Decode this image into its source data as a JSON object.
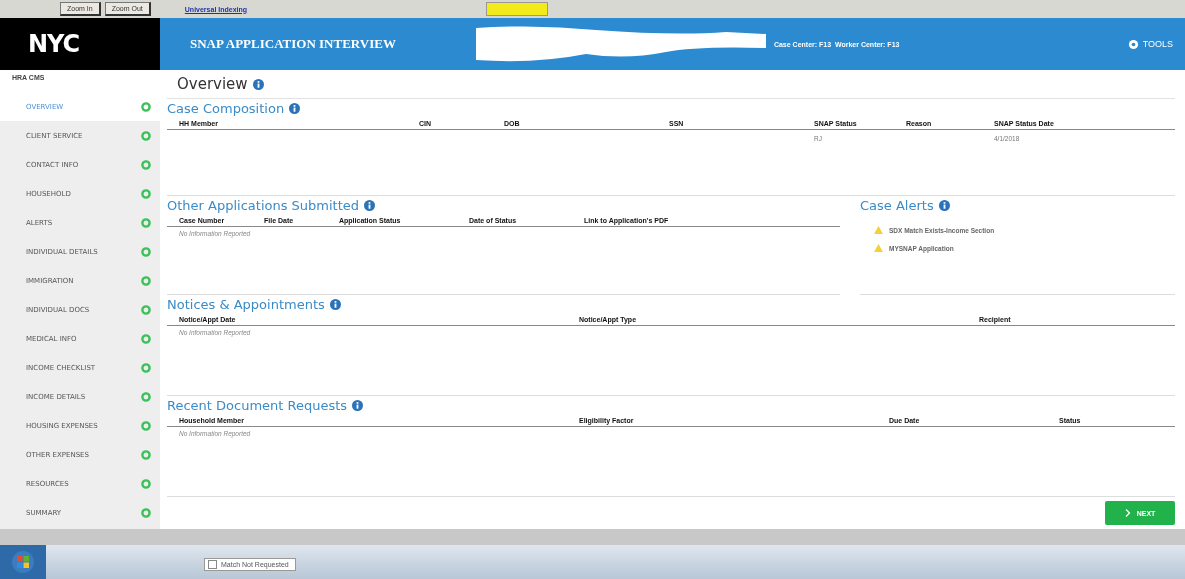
{
  "toolbar": {
    "buttons": [
      "Zoom In",
      "Zoom Out"
    ],
    "link": "Universal Indexing"
  },
  "header": {
    "logo": "NYC",
    "title": "SNAP APPLICATION INTERVIEW",
    "centers": "Case Center: F13  Worker Center: F13",
    "tools": "TOOLS"
  },
  "sidebar": {
    "caption": "HRA CMS",
    "items": [
      {
        "label": "OVERVIEW",
        "selected": true
      },
      {
        "label": "CLIENT SERVICE",
        "selected": false
      },
      {
        "label": "CONTACT INFO",
        "selected": false
      },
      {
        "label": "HOUSEHOLD",
        "selected": false
      },
      {
        "label": "ALERTS",
        "selected": false
      },
      {
        "label": "INDIVIDUAL DETAILS",
        "selected": false
      },
      {
        "label": "IMMIGRATION",
        "selected": false
      },
      {
        "label": "INDIVIDUAL DOCS",
        "selected": false
      },
      {
        "label": "MEDICAL INFO",
        "selected": false
      },
      {
        "label": "INCOME CHECKLIST",
        "selected": false
      },
      {
        "label": "INCOME DETAILS",
        "selected": false
      },
      {
        "label": "HOUSING EXPENSES",
        "selected": false
      },
      {
        "label": "OTHER EXPENSES",
        "selected": false
      },
      {
        "label": "RESOURCES",
        "selected": false
      },
      {
        "label": "SUMMARY",
        "selected": false
      }
    ]
  },
  "page_title": "Overview",
  "case_composition": {
    "title": "Case Composition",
    "columns": [
      "HH Member",
      "CIN",
      "DOB",
      "SSN",
      "SNAP Status",
      "Reason",
      "SNAP Status Date"
    ],
    "rows": [
      {
        "snap_status": "RJ",
        "snap_status_date": "4/1/2018"
      }
    ]
  },
  "other_applications": {
    "title": "Other Applications Submitted",
    "columns": [
      "Case Number",
      "File Date",
      "Application Status",
      "Date of Status",
      "Link to Application's PDF"
    ],
    "empty": "No Information Reported"
  },
  "case_alerts": {
    "title": "Case Alerts",
    "items": [
      "SDX Match Exists-Income Section",
      "MYSNAP Application"
    ]
  },
  "notices": {
    "title": "Notices & Appointments",
    "columns": [
      "Notice/Appt Date",
      "Notice/Appt Type",
      "Recipient"
    ],
    "empty": "No Information Reported"
  },
  "document_requests": {
    "title": "Recent Document Requests",
    "columns": [
      "Household Member",
      "Eligibility Factor",
      "Due Date",
      "Status"
    ],
    "empty": "No Information Reported"
  },
  "next_button": "NEXT",
  "taskbar": {
    "item": "Match Not Requested",
    "checked": false
  }
}
